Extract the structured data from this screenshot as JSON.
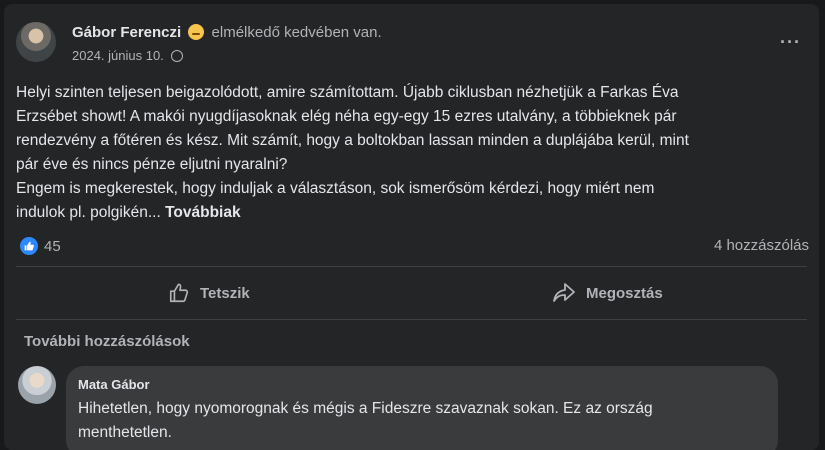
{
  "post": {
    "author": "Gábor Ferenczi",
    "feeling": "elmélkedő kedvében van.",
    "date": "2024. június 10.",
    "more_options": "···",
    "text_lines": [
      "Helyi szinten teljesen beigazolódott, amire számítottam. Újabb ciklusban nézhetjük a Farkas Éva",
      "Erzsébet showt! A makói nyugdíjasoknak elég néha egy-egy 15 ezres utalvány,  a többieknek pár",
      "rendezvény a főtéren és kész. Mit számít, hogy a boltokban lassan minden  a duplájába kerül, mint",
      "pár éve és nincs pénze eljutni nyaralni?",
      "Engem is megkerestek, hogy induljak a választáson, sok ismerősöm kérdezi, hogy miért nem",
      "indulok pl. polgikén... "
    ],
    "see_more": "Továbbiak",
    "reaction_count": "45",
    "comments_count": "4 hozzászólás",
    "like_label": "Tetszik",
    "share_label": "Megosztás"
  },
  "comments": {
    "more_label": "További hozzászólások",
    "items": [
      {
        "author": "Mata Gábor",
        "text_lines": [
          "Hihetetlen, hogy nyomorognak és mégis a Fideszre szavaznak sokan. Ez az ország",
          "menthetetlen."
        ]
      }
    ]
  },
  "colors": {
    "background": "#18191a",
    "card": "#242526",
    "bubble": "#3a3b3c",
    "like_blue": "#2d88ff",
    "text_primary": "#e4e6eb",
    "text_secondary": "#b0b3b8"
  },
  "icons": {
    "feeling": "pensive-face-icon",
    "privacy": "globe-icon",
    "reaction": "like-reaction-icon",
    "like_action": "thumbs-up-icon",
    "share_action": "share-arrow-icon"
  }
}
